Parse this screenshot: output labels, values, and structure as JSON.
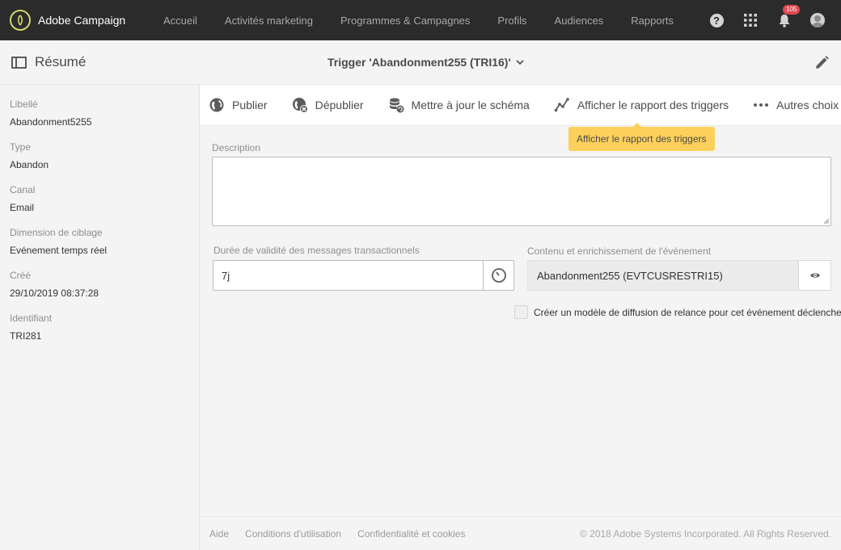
{
  "app": {
    "name": "Adobe Campaign",
    "nav": [
      "Accueil",
      "Activités marketing",
      "Programmes & Campagnes",
      "Profils",
      "Audiences",
      "Rapports"
    ],
    "notifications_count": "105"
  },
  "header": {
    "summary_label": "Résumé",
    "title": "Trigger 'Abandonment255 (TRI16)'"
  },
  "sidebar": {
    "fields": [
      {
        "label": "Libellé",
        "value": "Abandonment5255"
      },
      {
        "label": "Type",
        "value": "Abandon"
      },
      {
        "label": "Canal",
        "value": "Email"
      },
      {
        "label": "Dimension de ciblage",
        "value": "Evénement temps réel"
      },
      {
        "label": "Créé",
        "value": "29/10/2019 08:37:28"
      },
      {
        "label": "Identifiant",
        "value": "TRI281"
      }
    ]
  },
  "toolbar": {
    "publish": "Publier",
    "unpublish": "Dépublier",
    "update_schema": "Mettre à jour le schéma",
    "show_report": "Afficher le rapport des triggers",
    "more": "Autres choix"
  },
  "tooltip": "Afficher le rapport des triggers",
  "form": {
    "description_label": "Description",
    "description_value": "",
    "validity_label": "Durée de validité des messages transactionnels",
    "validity_value": "7j",
    "event_label": "Contenu et enrichissement de l'événement",
    "event_value": "Abandonment255 (EVTCUSRESTRI15)",
    "checkbox_label": "Créer un modèle de diffusion de relance pour cet événement déclencheur"
  },
  "footer": {
    "links": [
      "Aide",
      "Conditions d'utilisation",
      "Confidentialité et cookies"
    ],
    "copyright": "© 2018 Adobe Systems Incorporated. All Rights Reserved."
  },
  "colors": {
    "topbar": "#2b2b2b",
    "tooltip": "#fdd05b",
    "badge": "#e34850"
  }
}
